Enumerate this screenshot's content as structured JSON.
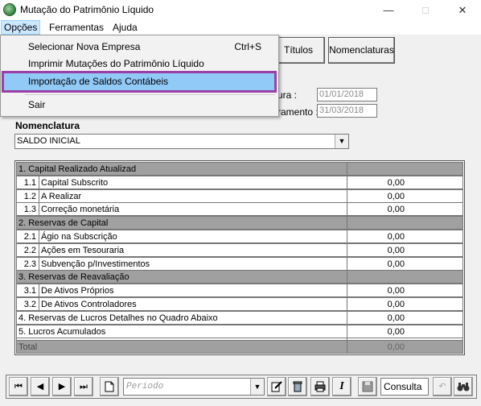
{
  "window": {
    "title": "Mutação do Patrimônio Líquido"
  },
  "menubar": {
    "items": [
      "Opções",
      "Ferramentas",
      "Ajuda"
    ]
  },
  "dropdown": {
    "items": [
      {
        "label": "Selecionar Nova Empresa",
        "shortcut": "Ctrl+S"
      },
      {
        "label": "Imprimir Mutações do Patrimônio Líquido",
        "shortcut": ""
      },
      {
        "label": "Importação de Saldos Contábeis",
        "shortcut": ""
      },
      {
        "label": "Sair",
        "shortcut": ""
      }
    ]
  },
  "toolbar": {
    "titulos_label": "Títulos",
    "nomenclaturas_label": "Nomenclaturas"
  },
  "dates": {
    "label1": "ura :",
    "value1": "01/01/2018",
    "label2": "ramento :",
    "value2": "31/03/2018"
  },
  "nomenclatura": {
    "label": "Nomenclatura",
    "selected": "SALDO INICIAL"
  },
  "grid": {
    "rows": [
      {
        "type": "header",
        "label": "1. Capital Realizado Atualizad",
        "value": ""
      },
      {
        "type": "item",
        "num": "1.1",
        "label": "Capital Subscrito",
        "value": "0,00"
      },
      {
        "type": "item",
        "num": "1.2",
        "label": "A Realizar",
        "value": "0,00"
      },
      {
        "type": "item",
        "num": "1.3",
        "label": "Correção monetária",
        "value": "0,00"
      },
      {
        "type": "header",
        "label": "2. Reservas  de Capital",
        "value": ""
      },
      {
        "type": "item",
        "num": "2.1",
        "label": "Ágio na Subscrição",
        "value": "0,00"
      },
      {
        "type": "item",
        "num": "2.2",
        "label": "Ações em Tesouraria",
        "value": "0,00"
      },
      {
        "type": "item",
        "num": "2.3",
        "label": "Subvenção p/Investimentos",
        "value": "0,00"
      },
      {
        "type": "header",
        "label": "3. Reservas de Reavaliação",
        "value": ""
      },
      {
        "type": "item",
        "num": "3.1",
        "label": "De Ativos Próprios",
        "value": "0,00"
      },
      {
        "type": "item",
        "num": "3.2",
        "label": "De Ativos Controladores",
        "value": "0,00"
      },
      {
        "type": "plain",
        "label": "4. Reservas de Lucros Detalhes no Quadro Abaixo",
        "value": "0,00"
      },
      {
        "type": "plain",
        "label": "5. Lucros Acumulados",
        "value": "0,00"
      },
      {
        "type": "plain",
        "label": "",
        "value": ""
      },
      {
        "type": "total",
        "label": "Total",
        "value": "0,00"
      }
    ]
  },
  "bottombar": {
    "periodo_placeholder": "Periodo",
    "mode": "Consulta"
  }
}
